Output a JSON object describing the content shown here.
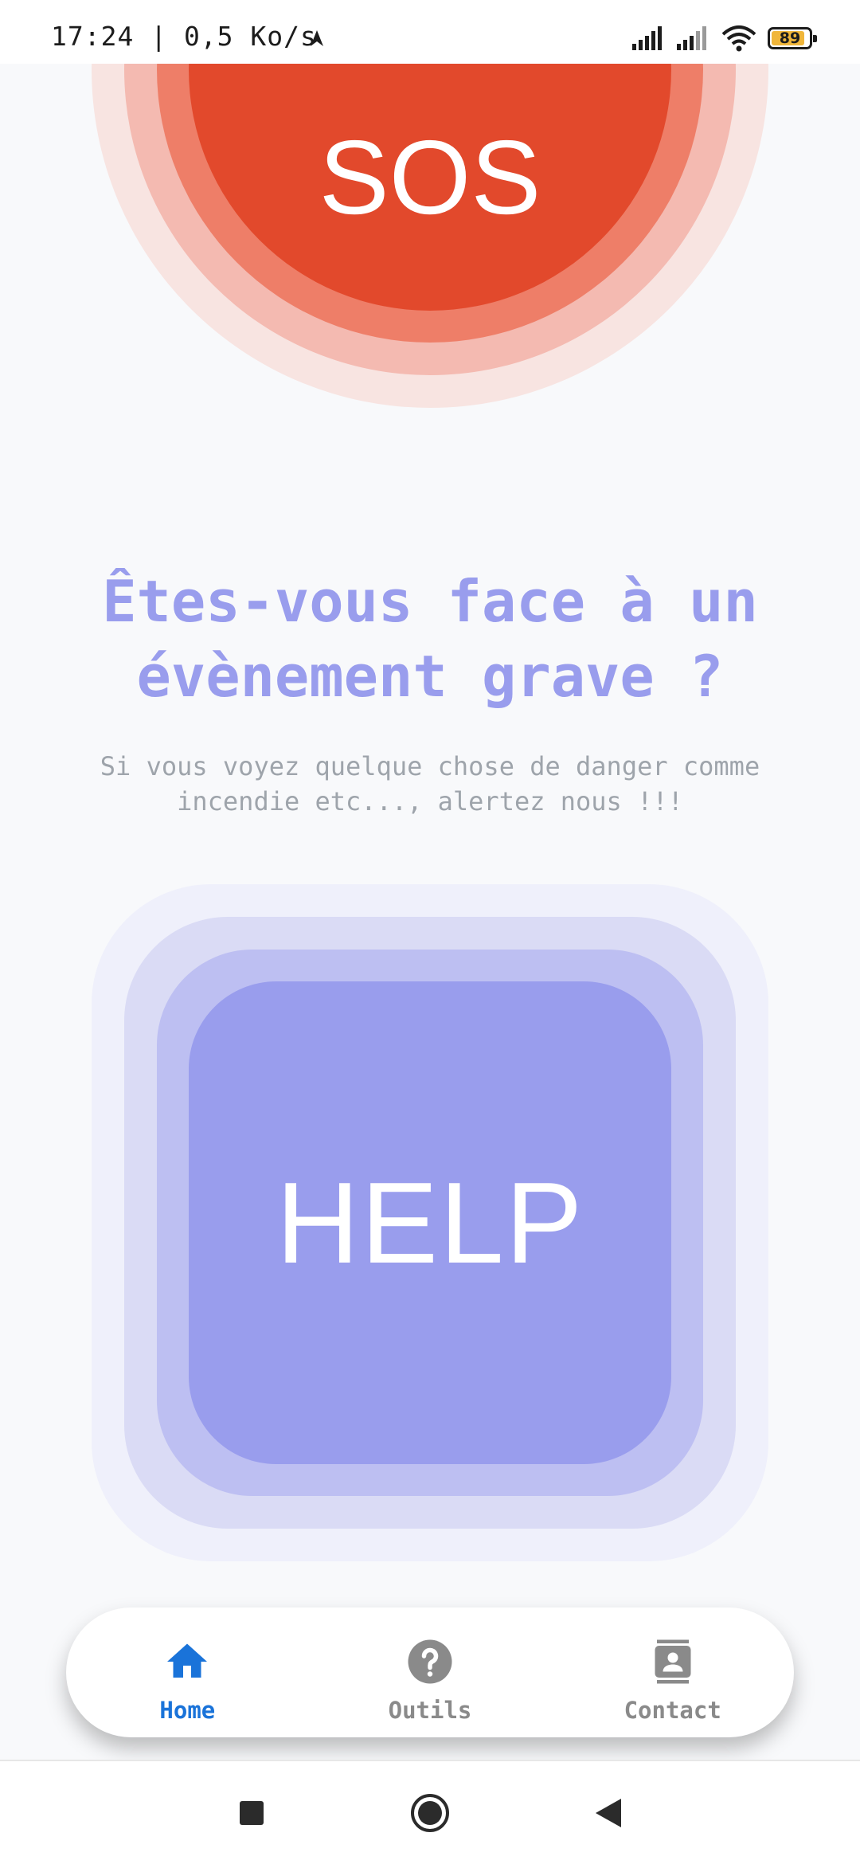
{
  "status_bar": {
    "time_speed": "17:24 | 0,5 Ko/s",
    "battery_level": "89",
    "battery_fraction": 0.89,
    "battery_color": "#f0b63a"
  },
  "sos_button": {
    "label": "SOS",
    "color": "#e2492c"
  },
  "headline": "Êtes-vous face à un évènement grave ?",
  "subtext": "Si vous voyez quelque chose de danger comme incendie etc..., alertez nous !!!",
  "help_button": {
    "label": "HELP",
    "color": "#999ded"
  },
  "bottom_nav": {
    "active": "Home",
    "items": [
      {
        "label": "Home",
        "icon": "home-icon"
      },
      {
        "label": "Outils",
        "icon": "help-circle-icon"
      },
      {
        "label": "Contact",
        "icon": "contact-card-icon"
      }
    ],
    "active_color": "#1a73d9",
    "inactive_color": "#8a8a8a"
  },
  "system_nav": {
    "icons": [
      "recent-apps-icon",
      "home-circle-icon",
      "back-icon"
    ]
  }
}
